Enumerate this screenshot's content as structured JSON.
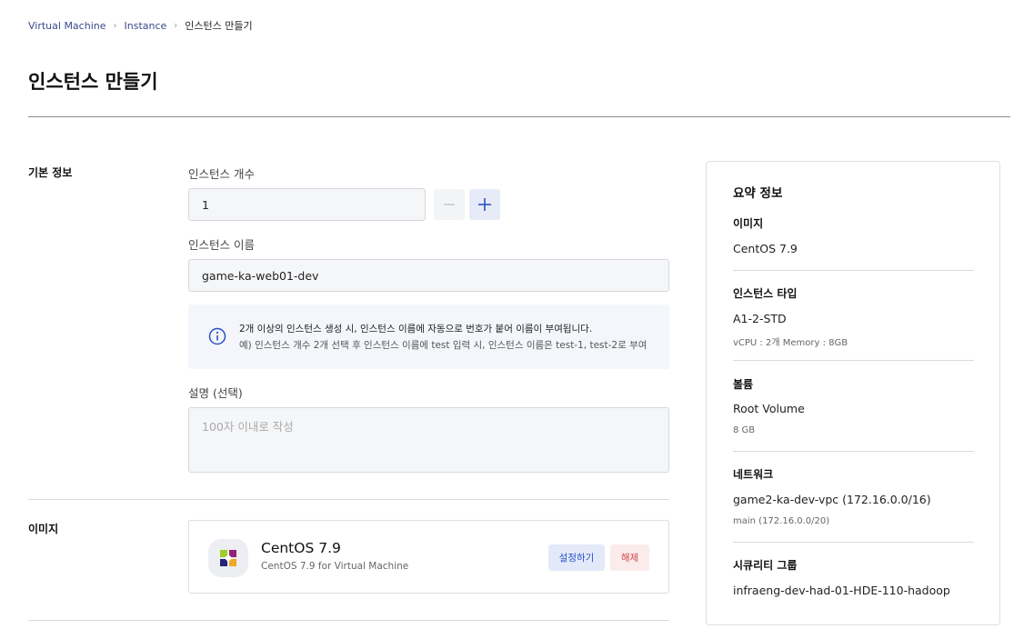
{
  "breadcrumb": {
    "items": [
      "Virtual Machine",
      "Instance"
    ],
    "current": "인스턴스 만들기"
  },
  "page": {
    "title": "인스턴스 만들기"
  },
  "basic_info": {
    "section_label": "기본 정보",
    "count_label": "인스턴스 개수",
    "count_value": "1",
    "name_label": "인스턴스 이름",
    "name_value": "game-ka-web01-dev",
    "info_line1": "2개 이상의 인스턴스 생성 시, 인스턴스 이름에 자동으로 번호가 붙어 이름이 부여됩니다.",
    "info_line2": "예) 인스턴스 개수 2개 선택 후 인스턴스 이름에 test 입력 시, 인스턴스 이름은 test-1, test-2로 부여",
    "desc_label": "설명 (선택)",
    "desc_placeholder": "100자 이내로 작성"
  },
  "image": {
    "section_label": "이미지",
    "os_name": "CentOS 7.9",
    "os_desc": "CentOS 7.9 for Virtual Machine",
    "config_label": "설정하기",
    "release_label": "해제"
  },
  "summary": {
    "title": "요약 정보",
    "image_head": "이미지",
    "image_value": "CentOS 7.9",
    "type_head": "인스턴스 타입",
    "type_value": "A1-2-STD",
    "type_sub": "vCPU : 2개 Memory : 8GB",
    "volume_head": "볼륨",
    "volume_value": "Root Volume",
    "volume_sub": "8 GB",
    "network_head": "네트워크",
    "network_value": "game2-ka-dev-vpc (172.16.0.0/16)",
    "network_sub": "main (172.16.0.0/20)",
    "sg_head": "시큐리티 그룹",
    "sg_value": "infraeng-dev-had-01-HDE-110-hadoop"
  },
  "colors": {
    "accent": "#2b50c5",
    "danger": "#d64545",
    "input_bg": "#f5f6f8"
  },
  "icons": {
    "minus": "minus-icon",
    "plus": "plus-icon",
    "info": "info-icon",
    "os_logo": "centos-logo-icon",
    "breadcrumb_separator": "chevron-right-icon"
  }
}
